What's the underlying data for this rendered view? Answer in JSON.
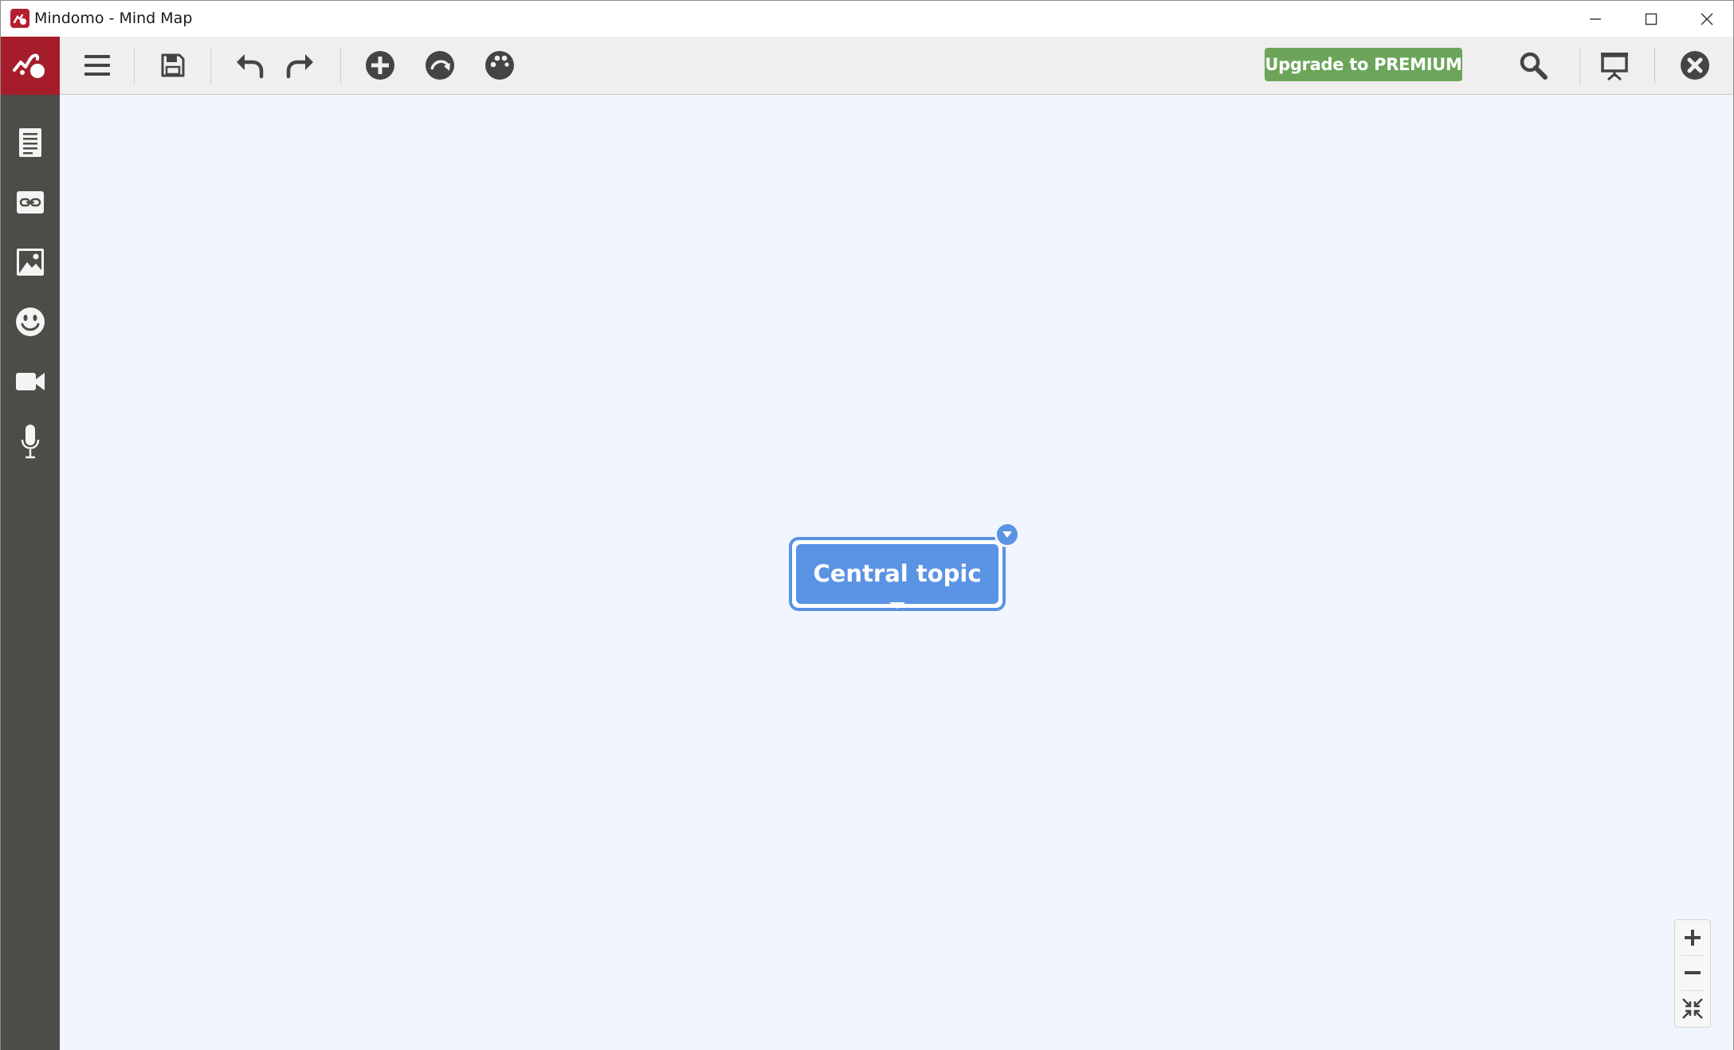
{
  "window": {
    "title": "Mindomo - Mind Map"
  },
  "toolbar": {
    "premium_label": "Upgrade to PREMIUM",
    "buttons": [
      "menu-icon",
      "save-icon",
      "undo-icon",
      "redo-icon",
      "add-topic-icon",
      "relationship-icon",
      "theme-icon",
      "search-icon",
      "presentation-icon",
      "close-map-icon"
    ]
  },
  "sidebar": {
    "items": [
      "notes-icon",
      "link-icon",
      "image-icon",
      "emoticon-icon",
      "video-icon",
      "microphone-icon"
    ]
  },
  "map": {
    "central_topic": "Central topic"
  },
  "zoom": {
    "controls": [
      "zoom-in-icon",
      "zoom-out-icon",
      "fit-map-icon"
    ]
  },
  "colors": {
    "brand": "#a51d2b",
    "topic": "#5b93e4",
    "premium": "#6ca55a",
    "sidebar": "#4d4c46",
    "canvas": "#f1f5fd"
  }
}
